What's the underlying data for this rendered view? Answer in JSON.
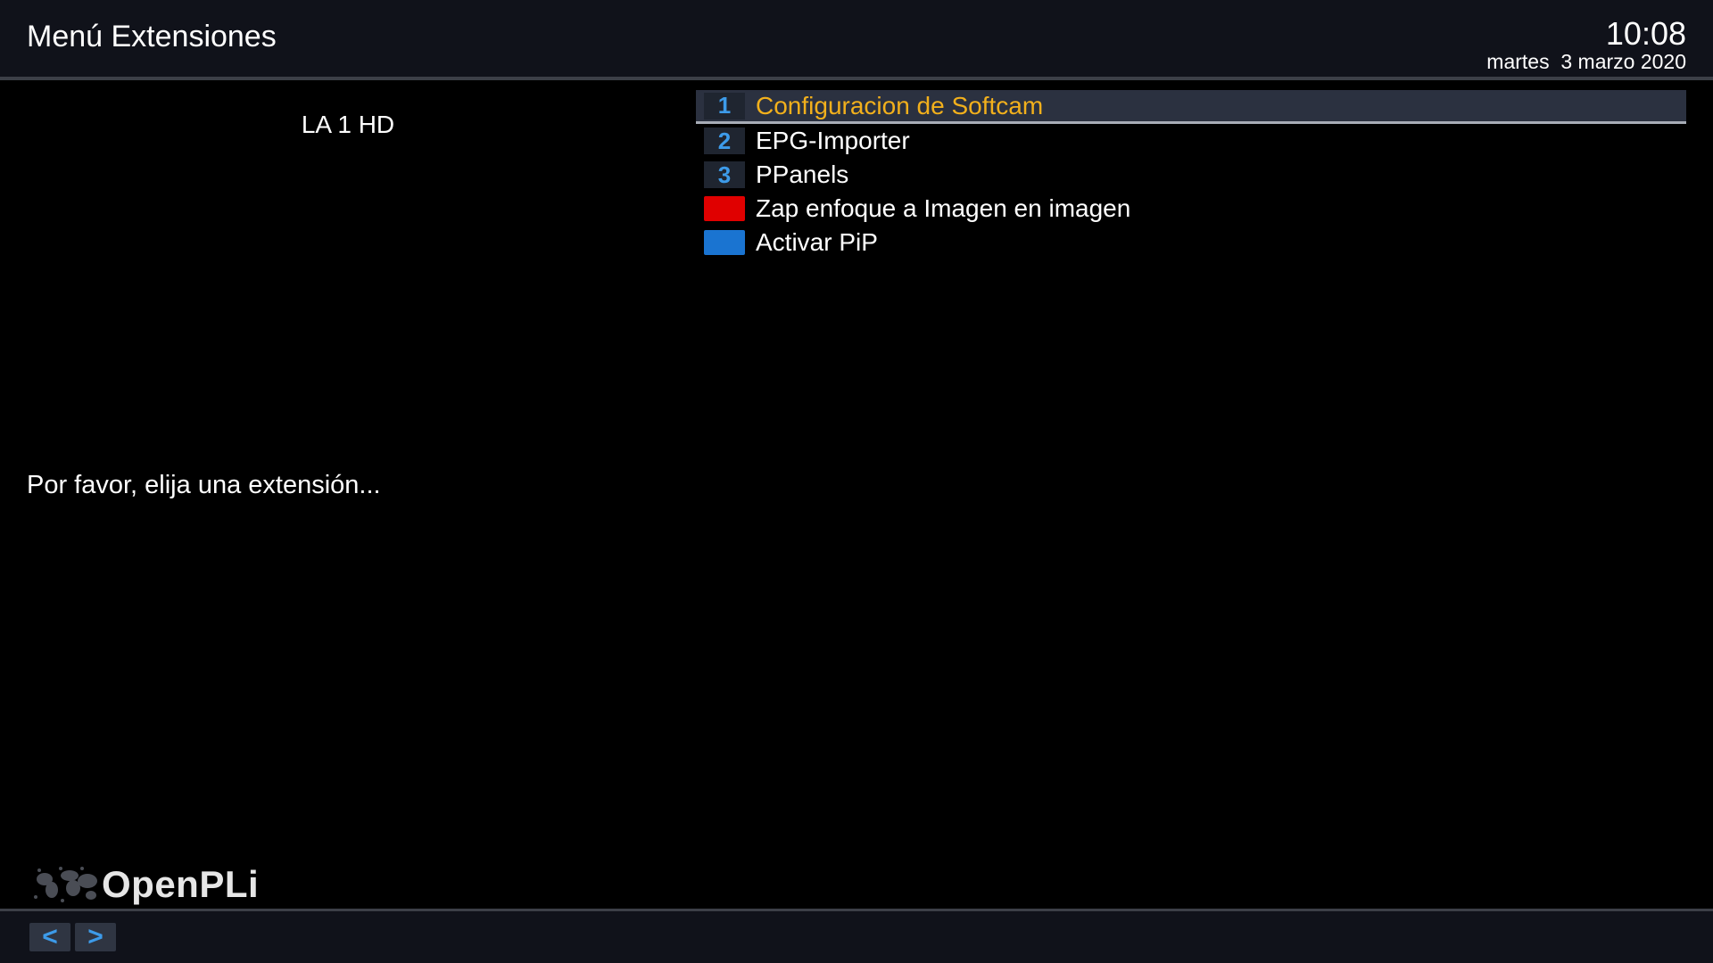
{
  "header": {
    "title": "Menú Extensiones",
    "time": "10:08",
    "date": "martes  3 marzo 2020"
  },
  "service": {
    "name": "LA 1 HD"
  },
  "description": "Por favor, elija una extensión...",
  "list": {
    "items": [
      {
        "key": "1",
        "label": "Configuracion de Softcam",
        "selected": true
      },
      {
        "key": "2",
        "label": "EPG-Importer",
        "selected": false
      },
      {
        "key": "3",
        "label": "PPanels",
        "selected": false
      },
      {
        "key": "",
        "key_color": "#e00000",
        "label": "Zap enfoque a Imagen en imagen",
        "selected": false
      },
      {
        "key": "",
        "key_color": "#1a74d1",
        "label": "Activar PiP",
        "selected": false
      }
    ]
  },
  "logo": {
    "text": "OpenPLi",
    "icon": "globe-icon"
  },
  "footer": {
    "prev_label": "<",
    "next_label": ">"
  },
  "colors": {
    "selected_text": "#f2b01c",
    "key_number": "#3d9be9",
    "header_bg": "#10121a"
  }
}
